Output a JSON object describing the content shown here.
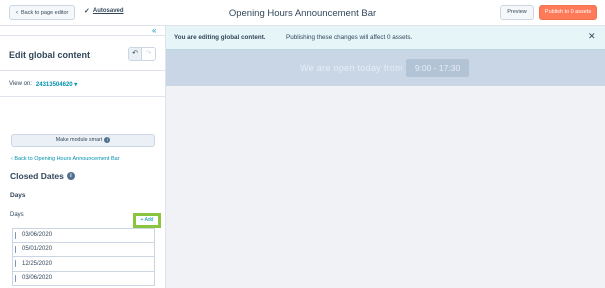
{
  "topbar": {
    "back_label": "Back to page editor",
    "autosaved_label": "Autosaved",
    "title": "Opening Hours Announcement Bar",
    "preview_label": "Preview",
    "publish_label": "Publish to 0 assets"
  },
  "sidebar": {
    "title": "Edit global content",
    "view_on_label": "View on:",
    "view_on_value": "24313504620",
    "make_smart_label": "Make module smart",
    "back_link": "Back to Opening Hours Announcement Bar",
    "section_title": "Closed Dates",
    "days_heading": "Days",
    "days_label": "Days",
    "add_label": "+ Add",
    "dates": [
      "03/06/2020",
      "05/01/2020",
      "12/25/2020",
      "03/06/2020"
    ]
  },
  "banner": {
    "strong_text": "You are editing global content.",
    "text": "Publishing these changes will affect 0 assets."
  },
  "announcement": {
    "text": "We are open today from",
    "hours": "9:00 - 17:30"
  },
  "colors": {
    "accent": "#0091ae",
    "publish": "#ff7a59",
    "highlight_border": "#8bc53f",
    "banner_bg": "#e5f5f8",
    "announce_bg": "#c8d6e6"
  },
  "icons": [
    "chevron-left-icon",
    "check-icon",
    "double-chevron-left-icon",
    "undo-icon",
    "redo-icon",
    "chevron-down-icon",
    "info-icon",
    "close-icon",
    "drag-handle-icon"
  ]
}
